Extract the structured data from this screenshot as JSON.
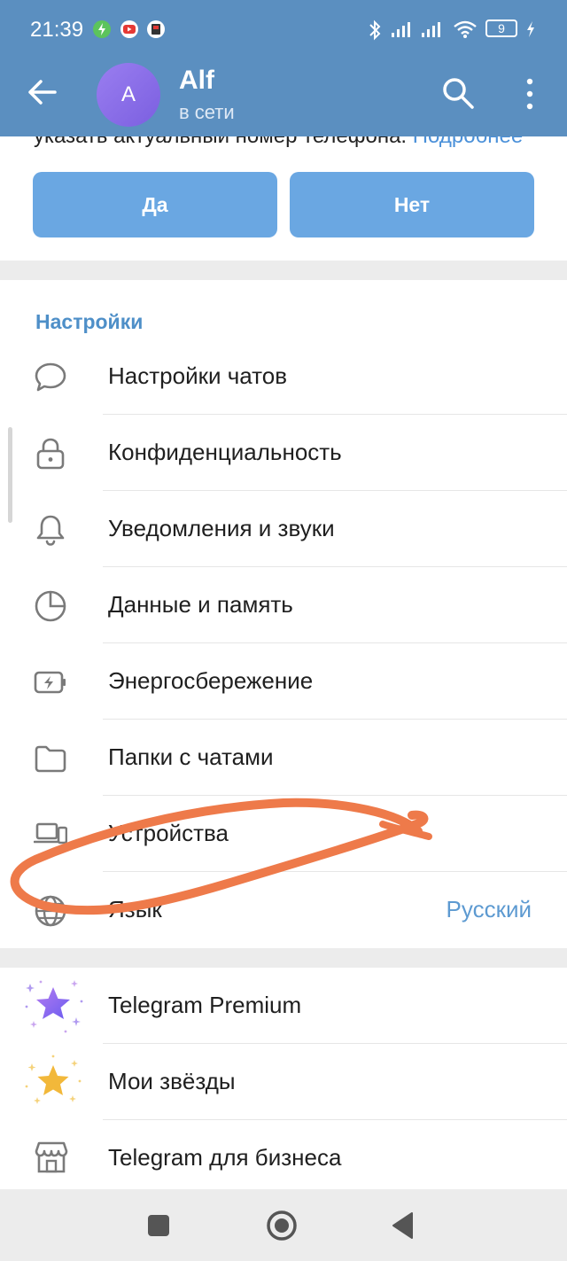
{
  "status_bar": {
    "time": "21:39",
    "battery": "9"
  },
  "header": {
    "avatar_letter": "A",
    "name": "Alf",
    "status": "в сети"
  },
  "notice": {
    "text": "указать актуальный номер телефона.",
    "link": "Подробнее",
    "yes_label": "Да",
    "no_label": "Нет"
  },
  "settings": {
    "title": "Настройки",
    "items": [
      {
        "icon": "chat-bubble-icon",
        "label": "Настройки чатов"
      },
      {
        "icon": "lock-icon",
        "label": "Конфиденциальность"
      },
      {
        "icon": "bell-icon",
        "label": "Уведомления и звуки"
      },
      {
        "icon": "pie-clock-icon",
        "label": "Данные и память"
      },
      {
        "icon": "battery-icon",
        "label": "Энергосбережение"
      },
      {
        "icon": "folder-icon",
        "label": "Папки с чатами"
      },
      {
        "icon": "devices-icon",
        "label": "Устройства"
      },
      {
        "icon": "globe-icon",
        "label": "Язык",
        "value": "Русский"
      }
    ]
  },
  "premium": {
    "items": [
      {
        "icon": "premium-star-icon",
        "label": "Telegram Premium"
      },
      {
        "icon": "gold-star-icon",
        "label": "Мои звёзды"
      },
      {
        "icon": "shop-icon",
        "label": "Telegram для бизнеса"
      }
    ]
  },
  "colors": {
    "header_bg": "#5b8fc0",
    "accent": "#4e8fc8",
    "button_bg": "#6aa7e2",
    "annotation": "#ee7a4a"
  }
}
